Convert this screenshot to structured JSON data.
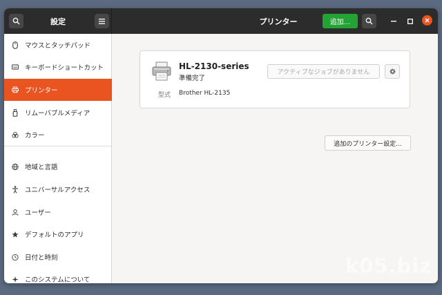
{
  "header": {
    "sidebar_title": "設定",
    "page_title": "プリンター",
    "add_button": "追加..."
  },
  "sidebar": {
    "items": [
      {
        "label": "マウスとタッチパッド",
        "icon": "mouse-icon"
      },
      {
        "label": "キーボードショートカット",
        "icon": "keyboard-icon"
      },
      {
        "label": "プリンター",
        "icon": "printer-icon",
        "active": true
      },
      {
        "label": "リムーバブルメディア",
        "icon": "removable-media-icon"
      },
      {
        "label": "カラー",
        "icon": "color-icon"
      },
      {
        "label": "地域と言語",
        "icon": "globe-icon"
      },
      {
        "label": "ユニバーサルアクセス",
        "icon": "accessibility-icon"
      },
      {
        "label": "ユーザー",
        "icon": "user-icon"
      },
      {
        "label": "デフォルトのアプリ",
        "icon": "star-icon"
      },
      {
        "label": "日付と時刻",
        "icon": "clock-icon"
      },
      {
        "label": "このシステムについて",
        "icon": "info-sparkle-icon"
      }
    ]
  },
  "printer": {
    "name": "HL-2130-series",
    "status": "準備完了",
    "jobs_button": "アクティブなジョブがありません",
    "model_label": "型式",
    "model_value": "Brother HL-2135"
  },
  "extra_settings_button": "追加のプリンター設定...",
  "watermark": "k05.biz",
  "colors": {
    "accent": "#e95420",
    "add_button": "#23a333",
    "titlebar": "#2c2c2c"
  }
}
